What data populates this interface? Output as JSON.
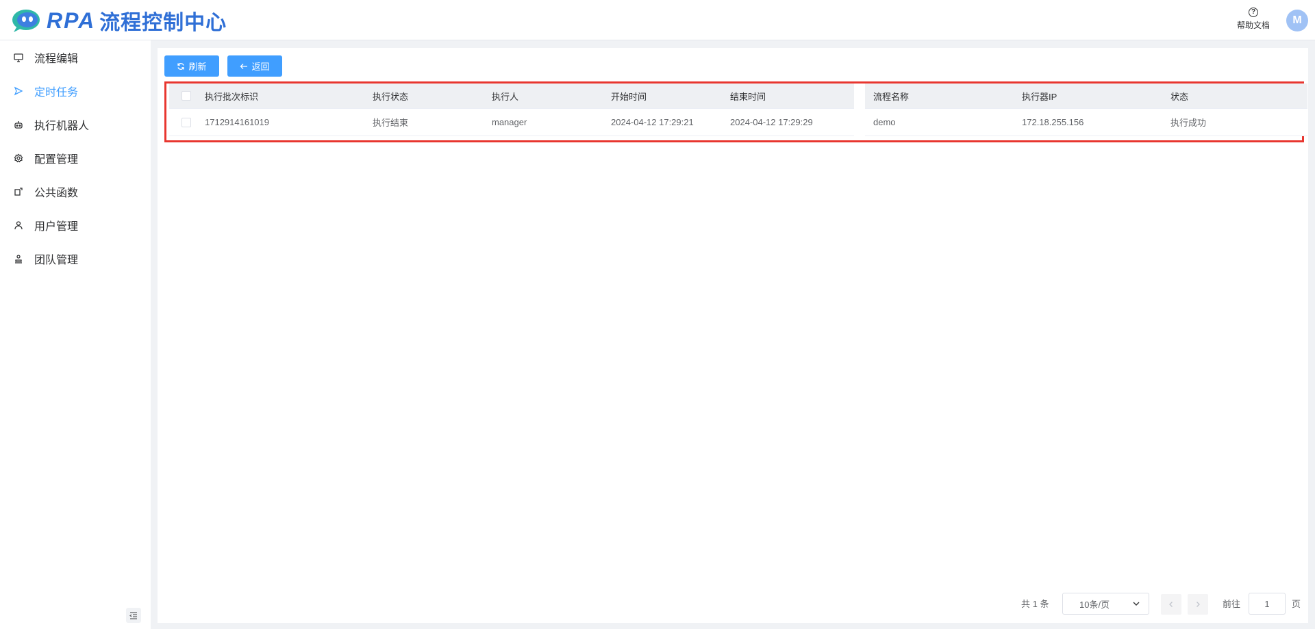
{
  "header": {
    "logo_text": "RPA",
    "title": "流程控制中心",
    "help_label": "帮助文档",
    "avatar_initial": "M"
  },
  "sidebar": {
    "items": [
      {
        "label": "流程编辑",
        "icon": "monitor-icon",
        "active": false
      },
      {
        "label": "定时任务",
        "icon": "send-icon",
        "active": true
      },
      {
        "label": "执行机器人",
        "icon": "robot-icon",
        "active": false
      },
      {
        "label": "配置管理",
        "icon": "gear-icon",
        "active": false
      },
      {
        "label": "公共函数",
        "icon": "function-icon",
        "active": false
      },
      {
        "label": "用户管理",
        "icon": "user-icon",
        "active": false
      },
      {
        "label": "团队管理",
        "icon": "team-icon",
        "active": false
      }
    ],
    "accent_color": "#409eff"
  },
  "toolbar": {
    "refresh_label": "刷新",
    "back_label": "返回"
  },
  "table": {
    "columns": [
      "执行批次标识",
      "执行状态",
      "执行人",
      "开始时间",
      "结束时间",
      "流程名称",
      "执行器IP",
      "状态"
    ],
    "rows": [
      {
        "batch_id": "1712914161019",
        "exec_status": "执行结束",
        "executor": "manager",
        "start_time": "2024-04-12 17:29:21",
        "end_time": "2024-04-12 17:29:29",
        "flow_name": "demo",
        "executor_ip": "172.18.255.156",
        "status": "执行成功"
      }
    ],
    "highlight_color": "#e8362f",
    "success_color": "#67c23a"
  },
  "pagination": {
    "total": "共 1 条",
    "page_size": "10条/页",
    "goto_label": "前往",
    "current_page": "1",
    "page_suffix": "页"
  }
}
